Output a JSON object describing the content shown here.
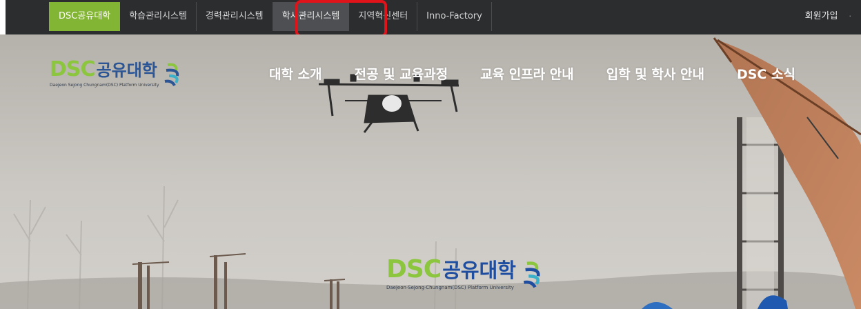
{
  "top_bar": {
    "tabs": [
      {
        "label": "DSC공유대학"
      },
      {
        "label": "학습관리시스템"
      },
      {
        "label": "경력관리시스템"
      },
      {
        "label": "학사관리시스템"
      },
      {
        "label": "지역혁신센터"
      },
      {
        "label": "Inno-Factory"
      }
    ],
    "active_tab": "DSC공유대학",
    "highlighted_tab": "학사관리시스템",
    "signup_label": "회원가입",
    "right_separator": "·"
  },
  "header": {
    "logo": {
      "main_latin": "DSC",
      "main_korean": "공유대학",
      "subtitle": "Daejeon Sejong Chungnam(DSC) Platform University",
      "icon": "dsc-swirl-icon"
    },
    "nav": [
      {
        "label": "대학 소개"
      },
      {
        "label": "전공 및 교육과정"
      },
      {
        "label": "교육 인프라 안내"
      },
      {
        "label": "입학 및 학사 안내"
      },
      {
        "label": "DSC 소식"
      }
    ]
  },
  "hero": {
    "logo": {
      "main_latin": "DSC",
      "main_korean": "공유대학",
      "subtitle": "Daejeon·Sejong·Chungnam(DSC) Platform University",
      "icon": "dsc-swirl-icon"
    },
    "background": "drone-field-photo"
  },
  "colors": {
    "topbar_bg": "#2b2d2f",
    "active_tab": "#83b534",
    "highlight_box": "#e0131b",
    "logo_green": "#8cc63f",
    "logo_blue": "#2b5594"
  }
}
